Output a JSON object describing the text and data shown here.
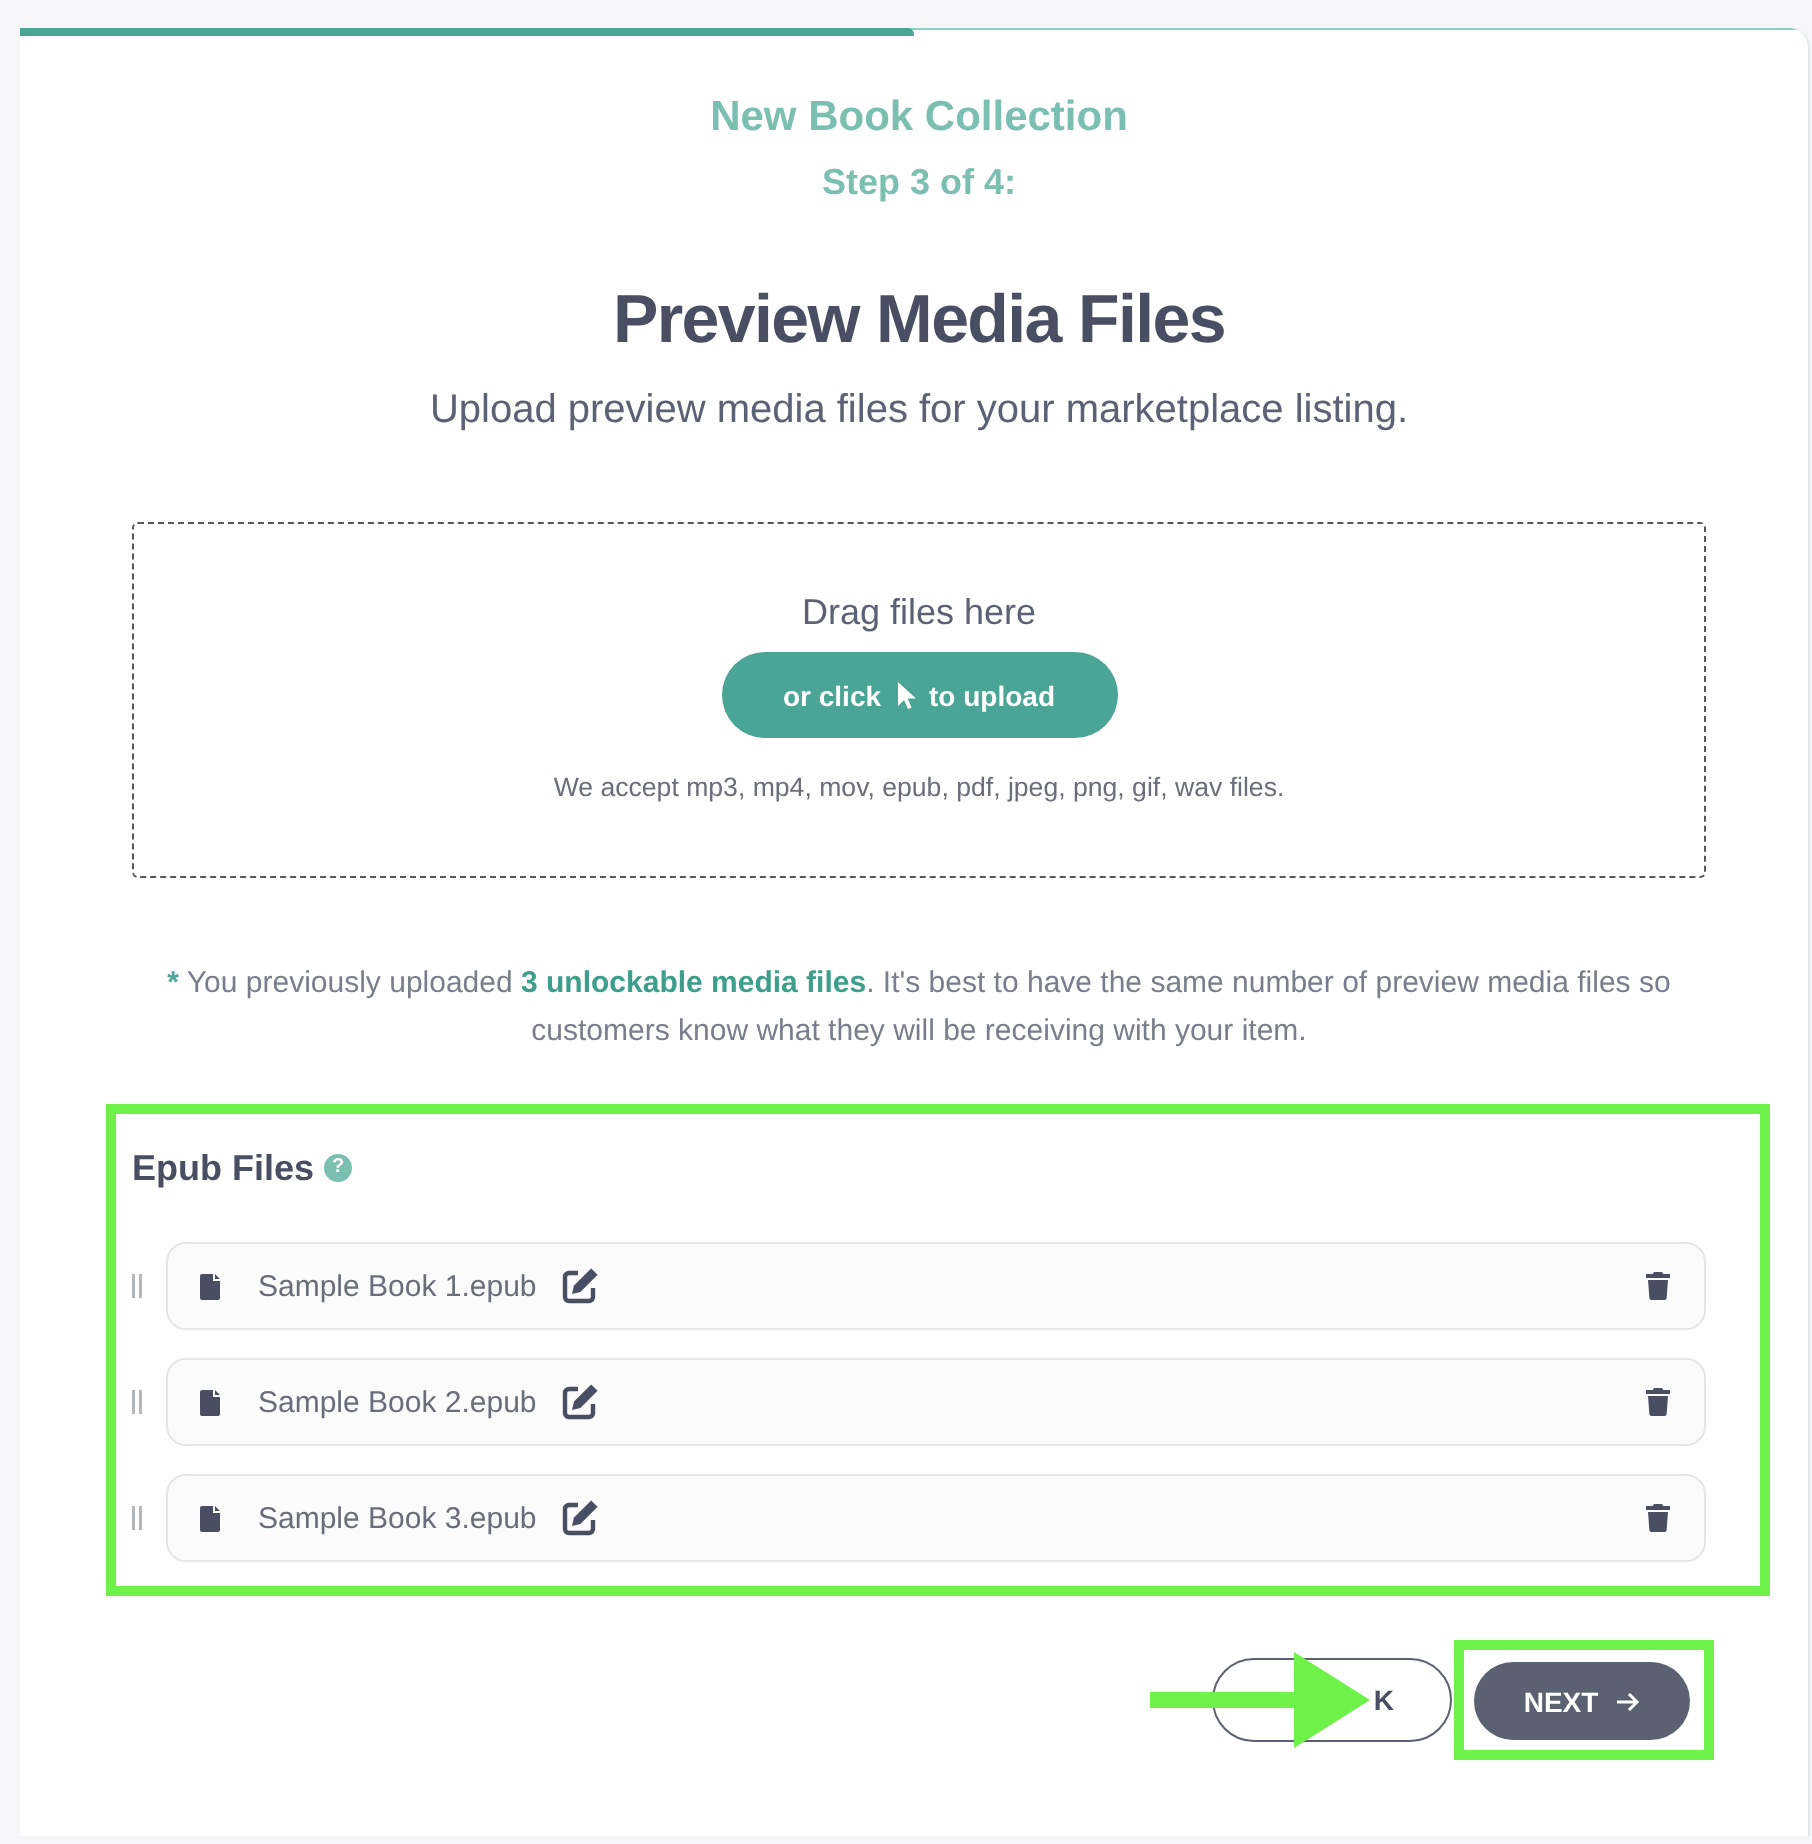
{
  "progress": {
    "level": 0.5
  },
  "header": {
    "collection": "New Book Collection",
    "step": "Step 3 of 4:",
    "title": "Preview Media Files",
    "subtitle": "Upload preview media files for your marketplace listing."
  },
  "dropzone": {
    "prompt": "Drag files here",
    "upload_button": {
      "label_before": "or click",
      "label_after": "to upload"
    },
    "accepted": "We accept mp3, mp4, mov, epub, pdf, jpeg, png, gif, wav files."
  },
  "note": {
    "marker": "*",
    "text": "You previously uploaded **3 unlockable media files**. It's best to have the same number of preview media files so customers know what they will be receiving with your item."
  },
  "file_section": {
    "title": "Epub Files",
    "help": "?",
    "highlighted": true,
    "files": [
      {
        "name": "Sample Book 1.epub"
      },
      {
        "name": "Sample Book 2.epub"
      },
      {
        "name": "Sample Book 3.epub"
      }
    ]
  },
  "footer": {
    "back_button": {
      "label": "K",
      "pointer_arrow": true
    },
    "next_button": {
      "label": "NEXT",
      "highlighted": true
    }
  }
}
